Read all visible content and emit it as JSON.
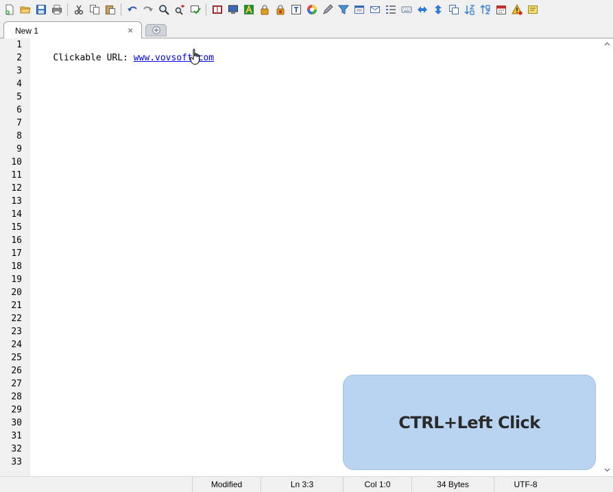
{
  "toolbar": {
    "buttons": [
      {
        "name": "new-file-icon"
      },
      {
        "name": "open-file-icon"
      },
      {
        "name": "save-icon"
      },
      {
        "name": "print-icon"
      },
      {
        "name": "cut-icon"
      },
      {
        "name": "copy-icon"
      },
      {
        "name": "paste-icon"
      },
      {
        "name": "undo-icon"
      },
      {
        "name": "redo-icon"
      },
      {
        "name": "find-icon"
      },
      {
        "name": "replace-icon"
      },
      {
        "name": "goto-icon"
      },
      {
        "name": "book-icon"
      },
      {
        "name": "monitor-icon"
      },
      {
        "name": "font-icon"
      },
      {
        "name": "lock-icon"
      },
      {
        "name": "unlock-icon"
      },
      {
        "name": "text-icon"
      },
      {
        "name": "color-wheel-icon"
      },
      {
        "name": "pen-icon"
      },
      {
        "name": "filter-icon"
      },
      {
        "name": "window-icon"
      },
      {
        "name": "mail-icon"
      },
      {
        "name": "list-icon"
      },
      {
        "name": "keyboard-icon"
      },
      {
        "name": "left-right-arrow-icon"
      },
      {
        "name": "up-down-arrow-icon"
      },
      {
        "name": "duplicate-icon"
      },
      {
        "name": "sort-az-icon"
      },
      {
        "name": "sort-za-icon"
      },
      {
        "name": "calendar-icon"
      },
      {
        "name": "warning-icon"
      },
      {
        "name": "note-icon"
      }
    ]
  },
  "tabs": [
    {
      "label": "New 1",
      "close": "×"
    }
  ],
  "editor": {
    "line_numbers": [
      "1",
      "2",
      "3",
      "4",
      "5",
      "6",
      "7",
      "8",
      "9",
      "10",
      "11",
      "12",
      "13",
      "14",
      "15",
      "16",
      "17",
      "18",
      "19",
      "20",
      "21",
      "22",
      "23",
      "24",
      "25",
      "26",
      "27",
      "28",
      "29",
      "30",
      "31",
      "32",
      "33"
    ],
    "line1_prefix": "Clickable URL: ",
    "line1_link": "www.vovsoft.com"
  },
  "callout": {
    "text": "CTRL+Left Click"
  },
  "statusbar": {
    "modified": "Modified",
    "line": "Ln 3:3",
    "col": "Col 1:0",
    "size": "34 Bytes",
    "encoding": "UTF-8"
  },
  "colors": {
    "link": "#0000ee",
    "callout_bg": "#b8d4f0",
    "gutter_bg": "#f0f0f0"
  }
}
